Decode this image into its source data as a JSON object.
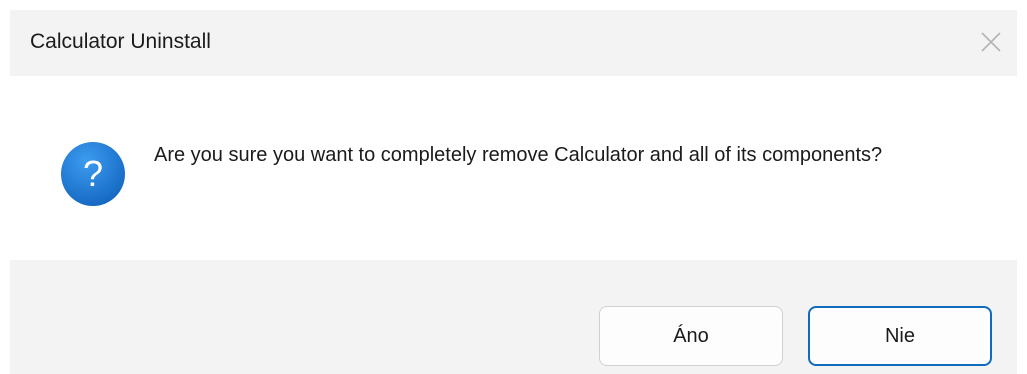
{
  "window": {
    "title": "Calculator Uninstall"
  },
  "dialog": {
    "message": "Are you sure you want to completely remove Calculator and all of its components?",
    "icon": "question-icon",
    "icon_color": "#1f7fd6"
  },
  "buttons": {
    "yes_label": "Áno",
    "no_label": "Nie"
  },
  "colors": {
    "accent": "#0f6cbd",
    "titlebar_bg": "#f3f3f3",
    "footer_bg": "#f3f3f3"
  }
}
